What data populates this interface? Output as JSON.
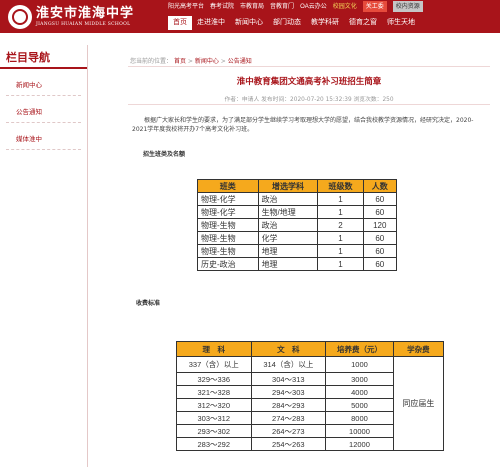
{
  "header": {
    "logo_text": "淮安市淮海中学",
    "logo_subtitle": "JIANGSU HUAIAN MIDDLE SCHOOL",
    "topbar": [
      "阳光高考平台",
      "春考试院",
      "市教育局",
      "音教育门",
      "OA云办公",
      "校园文化",
      "关工委",
      "校内资源"
    ],
    "nav": [
      "首页",
      "走进淮中",
      "新闻中心",
      "部门动态",
      "教学科研",
      "德育之窗",
      "师生天地"
    ]
  },
  "sidebar": {
    "title": "栏目导航",
    "items": [
      "新闻中心",
      "公告通知",
      "媒体淮中"
    ]
  },
  "breadcrumb": {
    "prefix": "您当前的位置：",
    "home": "首页",
    "sep": ">",
    "news": "新闻中心",
    "notice": "公告通知"
  },
  "article": {
    "title": "淮中教育集团文通高考补习班招生简章",
    "meta": "作者：申请人  发布时间：2020-07-20 15:32:39  浏览次数：250",
    "paragraph": "根据广大家长和学生的要求，为了满足部分学生继续学习考取理想大学的愿望，结合我校教学资源情况，经研究决定，2020-2021学年度我校将开办7个高考文化补习班。",
    "section1": "招生班类及名额",
    "section2": "收费标准"
  },
  "table1": {
    "headers": [
      "班类",
      "增选学科",
      "班级数",
      "人数"
    ],
    "rows": [
      [
        "物理-化学",
        "政治",
        "1",
        "60"
      ],
      [
        "物理-化学",
        "生物/地理",
        "1",
        "60"
      ],
      [
        "物理-生物",
        "政治",
        "2",
        "120"
      ],
      [
        "物理-生物",
        "化学",
        "1",
        "60"
      ],
      [
        "物理-生物",
        "地理",
        "1",
        "60"
      ],
      [
        "历史-政治",
        "地理",
        "1",
        "60"
      ]
    ]
  },
  "table2": {
    "headers": [
      "理　科",
      "文　科",
      "培养费（元）",
      "学杂费"
    ],
    "rows": [
      [
        "337（含）以上",
        "314（含）以上",
        "1000"
      ],
      [
        "329～336",
        "304～313",
        "3000"
      ],
      [
        "321～328",
        "294～303",
        "4000"
      ],
      [
        "312～320",
        "284～293",
        "5000"
      ],
      [
        "303～312",
        "274～283",
        "8000"
      ],
      [
        "293～302",
        "264～273",
        "10000"
      ],
      [
        "283～292",
        "254～263",
        "12000"
      ]
    ],
    "merged_fee": "同应届生"
  },
  "colors": {
    "brand": "#a8141a",
    "table_header": "#f5a91d"
  }
}
